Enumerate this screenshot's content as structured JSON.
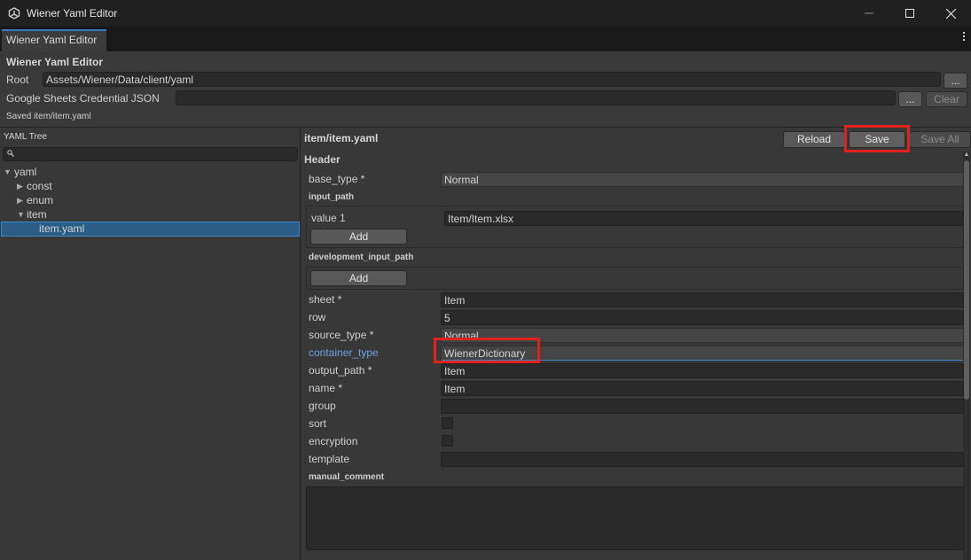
{
  "window": {
    "title": "Wiener Yaml Editor"
  },
  "tab": {
    "label": "Wiener Yaml Editor"
  },
  "header": {
    "title": "Wiener Yaml Editor",
    "root_label": "Root",
    "root_value": "Assets/Wiener/Data/client/yaml",
    "root_browse": "...",
    "credential_label": "Google Sheets Credential JSON",
    "credential_value": "",
    "credential_browse": "...",
    "clear_label": "Clear",
    "status": "Saved item/item.yaml"
  },
  "tree": {
    "title": "YAML Tree",
    "search_placeholder": "",
    "items": [
      {
        "label": "yaml",
        "arrow": "▼"
      },
      {
        "label": "const",
        "arrow": "▶"
      },
      {
        "label": "enum",
        "arrow": "▶"
      },
      {
        "label": "item",
        "arrow": "▼"
      },
      {
        "label": "item.yaml",
        "arrow": ""
      }
    ]
  },
  "editor": {
    "file_title": "item/item.yaml",
    "reload_label": "Reload",
    "save_label": "Save",
    "save_all_label": "Save All",
    "section_title": "Header",
    "base_type_label": "base_type *",
    "base_type_value": "Normal",
    "input_path_title": "input_path",
    "input_path_item_label": "value 1",
    "input_path_item_value": "Item/Item.xlsx",
    "add_label": "Add",
    "dev_input_path_title": "development_input_path",
    "dev_add_label": "Add",
    "sheet_label": "sheet *",
    "sheet_value": "Item",
    "row_label": "row",
    "row_value": "5",
    "source_type_label": "source_type *",
    "source_type_value": "Normal",
    "container_type_label": "container_type",
    "container_type_value": "WienerDictionary",
    "output_path_label": "output_path *",
    "output_path_value": "Item",
    "name_label": "name *",
    "name_value": "Item",
    "group_label": "group",
    "group_value": "",
    "sort_label": "sort",
    "sort_checked": false,
    "encryption_label": "encryption",
    "encryption_checked": false,
    "template_label": "template",
    "template_value": "",
    "manual_comment_title": "manual_comment",
    "manual_comment_value": ""
  },
  "colors": {
    "highlight": "#e0211e",
    "accent_label": "#6fa3e0",
    "selection": "#2c5d87"
  }
}
